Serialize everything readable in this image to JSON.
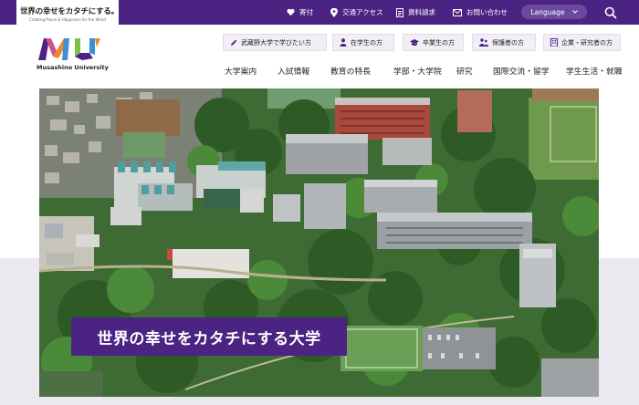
{
  "brand": {
    "tagline": "世界の幸せをカタチにする。",
    "tagline_en": "Creating Peace & Happiness for the World",
    "logo_name": "Musashino University",
    "logo_mark_text": "MU",
    "colors": {
      "primary": "#4b2382",
      "accent_orange": "#f0862a",
      "accent_green": "#7cc143",
      "accent_blue": "#3d8fd8",
      "accent_pink": "#d4508b"
    }
  },
  "utility": {
    "donate": "寄付",
    "access": "交通アクセス",
    "materials": "資料請求",
    "contact": "お問い合わせ",
    "language": "Language"
  },
  "audience": [
    {
      "label": "武蔵野大学で学びたい方",
      "icon": "pencil-icon"
    },
    {
      "label": "在学生の方",
      "icon": "student-icon"
    },
    {
      "label": "卒業生の方",
      "icon": "graduate-icon"
    },
    {
      "label": "保護者の方",
      "icon": "family-icon"
    },
    {
      "label": "企業・研究者の方",
      "icon": "building-icon"
    }
  ],
  "nav": [
    "大学案内",
    "入試情報",
    "教育の特長",
    "学部・大学院",
    "研究",
    "国際交流・留学",
    "学生生活・就職"
  ],
  "hero": {
    "catchcopy": "世界の幸せをカタチにする大学",
    "image": "aerial-campus-photo"
  }
}
